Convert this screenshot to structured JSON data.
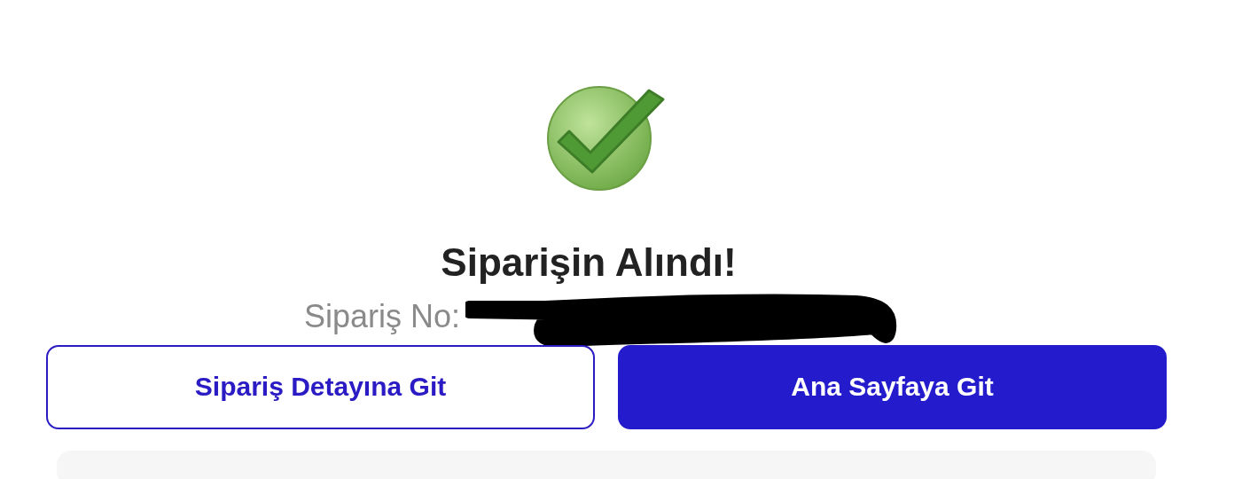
{
  "title": "Siparişin Alındı!",
  "order_label": "Sipariş No:",
  "buttons": [
    {
      "label": "Sipariş Detayına Git",
      "kind": "outline"
    },
    {
      "label": "Ana Sayfaya Git",
      "kind": "filled"
    }
  ]
}
